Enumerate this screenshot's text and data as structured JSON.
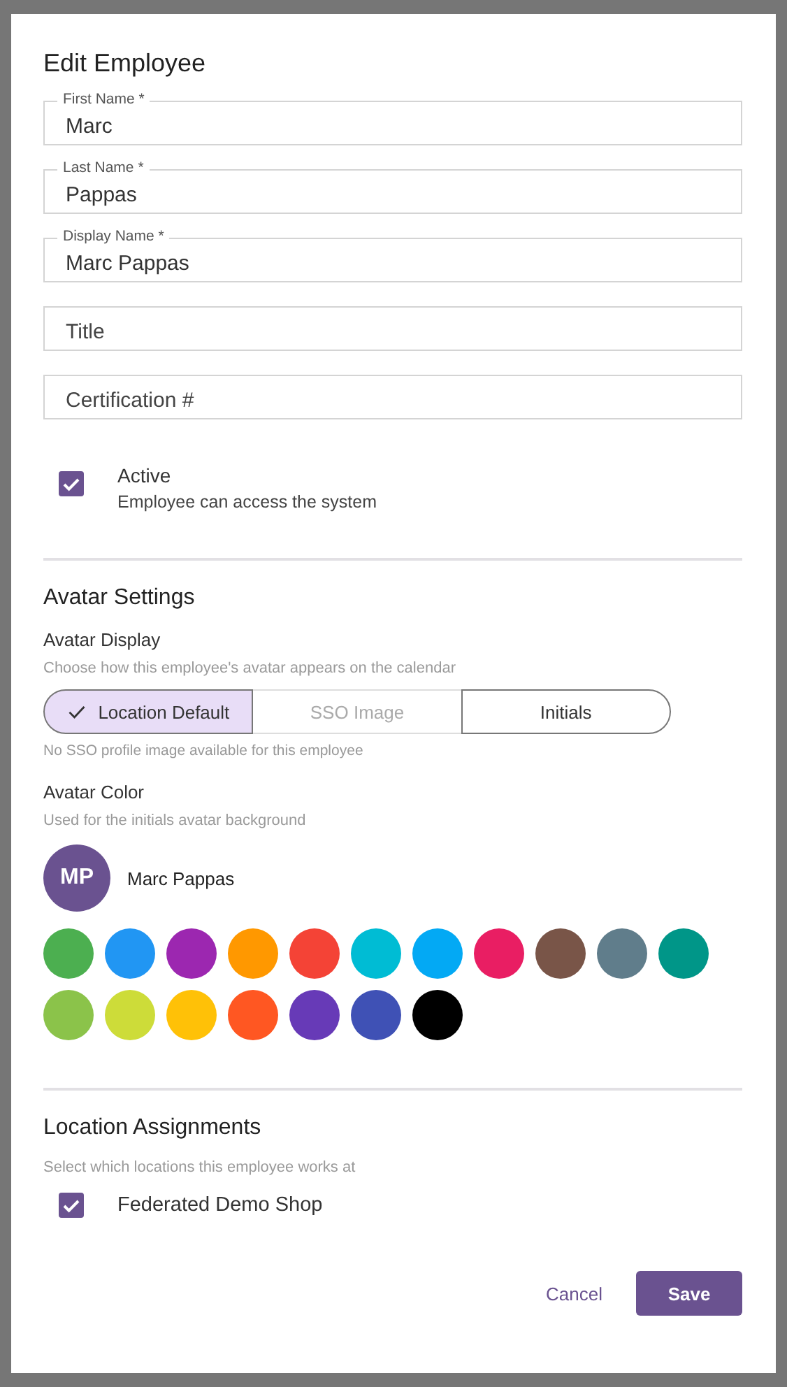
{
  "dialog": {
    "title": "Edit Employee",
    "fields": [
      {
        "label": "First Name *",
        "value": "Marc"
      },
      {
        "label": "Last Name *",
        "value": "Pappas"
      },
      {
        "label": "Display Name *",
        "value": "Marc Pappas"
      },
      {
        "placeholder": "Title"
      },
      {
        "placeholder": "Certification #"
      }
    ],
    "active": {
      "label": "Active",
      "description": "Employee can access the system",
      "checked": true
    },
    "avatar_settings": {
      "heading": "Avatar Settings",
      "display_label": "Avatar Display",
      "display_hint": "Choose how this employee's avatar appears on the calendar",
      "display_options": [
        {
          "label": "Location Default",
          "selected": true,
          "disabled": false
        },
        {
          "label": "SSO Image",
          "selected": false,
          "disabled": true
        },
        {
          "label": "Initials",
          "selected": false,
          "disabled": false
        }
      ],
      "display_note": "No SSO profile image available for this employee",
      "color_label": "Avatar Color",
      "color_hint": "Used for the initials avatar background",
      "preview": {
        "initials": "MP",
        "name": "Marc Pappas",
        "color": "#6a5290"
      },
      "swatches": [
        {
          "color": "#4caf50"
        },
        {
          "color": "#2196f3"
        },
        {
          "color": "#9c27b0"
        },
        {
          "color": "#ff9800"
        },
        {
          "color": "#f44336"
        },
        {
          "color": "#00bcd4"
        },
        {
          "color": "#03a9f4"
        },
        {
          "color": "#e91e63"
        },
        {
          "color": "#795548"
        },
        {
          "color": "#607d8b"
        },
        {
          "color": "#009688"
        },
        {
          "color": "#8bc34a"
        },
        {
          "color": "#cddc39"
        },
        {
          "color": "#ffc107"
        },
        {
          "color": "#ff5722"
        },
        {
          "color": "#673ab7"
        },
        {
          "color": "#3f51b5"
        },
        {
          "color": "#000000"
        }
      ]
    },
    "locations": {
      "heading": "Location Assignments",
      "hint": "Select which locations this employee works at",
      "items": [
        {
          "label": "Federated Demo Shop",
          "checked": true
        }
      ]
    },
    "buttons": [
      {
        "label": "Cancel",
        "kind": "text"
      },
      {
        "label": "Save",
        "kind": "primary"
      }
    ]
  }
}
